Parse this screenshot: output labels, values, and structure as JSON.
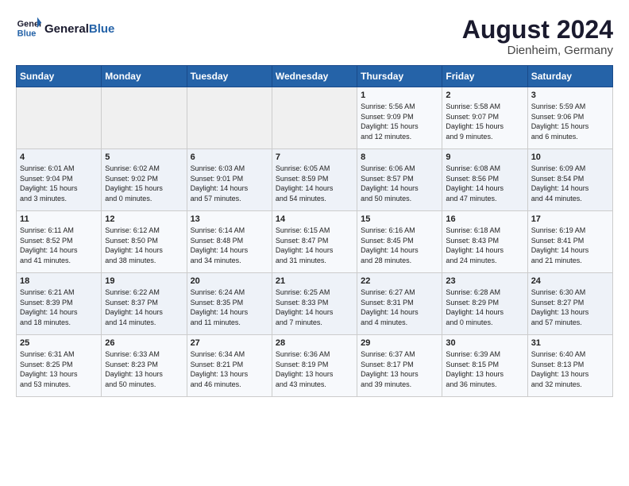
{
  "header": {
    "logo_line1": "General",
    "logo_line2": "Blue",
    "month_year": "August 2024",
    "location": "Dienheim, Germany"
  },
  "days_of_week": [
    "Sunday",
    "Monday",
    "Tuesday",
    "Wednesday",
    "Thursday",
    "Friday",
    "Saturday"
  ],
  "weeks": [
    [
      {
        "day": "",
        "info": ""
      },
      {
        "day": "",
        "info": ""
      },
      {
        "day": "",
        "info": ""
      },
      {
        "day": "",
        "info": ""
      },
      {
        "day": "1",
        "info": "Sunrise: 5:56 AM\nSunset: 9:09 PM\nDaylight: 15 hours\nand 12 minutes."
      },
      {
        "day": "2",
        "info": "Sunrise: 5:58 AM\nSunset: 9:07 PM\nDaylight: 15 hours\nand 9 minutes."
      },
      {
        "day": "3",
        "info": "Sunrise: 5:59 AM\nSunset: 9:06 PM\nDaylight: 15 hours\nand 6 minutes."
      }
    ],
    [
      {
        "day": "4",
        "info": "Sunrise: 6:01 AM\nSunset: 9:04 PM\nDaylight: 15 hours\nand 3 minutes."
      },
      {
        "day": "5",
        "info": "Sunrise: 6:02 AM\nSunset: 9:02 PM\nDaylight: 15 hours\nand 0 minutes."
      },
      {
        "day": "6",
        "info": "Sunrise: 6:03 AM\nSunset: 9:01 PM\nDaylight: 14 hours\nand 57 minutes."
      },
      {
        "day": "7",
        "info": "Sunrise: 6:05 AM\nSunset: 8:59 PM\nDaylight: 14 hours\nand 54 minutes."
      },
      {
        "day": "8",
        "info": "Sunrise: 6:06 AM\nSunset: 8:57 PM\nDaylight: 14 hours\nand 50 minutes."
      },
      {
        "day": "9",
        "info": "Sunrise: 6:08 AM\nSunset: 8:56 PM\nDaylight: 14 hours\nand 47 minutes."
      },
      {
        "day": "10",
        "info": "Sunrise: 6:09 AM\nSunset: 8:54 PM\nDaylight: 14 hours\nand 44 minutes."
      }
    ],
    [
      {
        "day": "11",
        "info": "Sunrise: 6:11 AM\nSunset: 8:52 PM\nDaylight: 14 hours\nand 41 minutes."
      },
      {
        "day": "12",
        "info": "Sunrise: 6:12 AM\nSunset: 8:50 PM\nDaylight: 14 hours\nand 38 minutes."
      },
      {
        "day": "13",
        "info": "Sunrise: 6:14 AM\nSunset: 8:48 PM\nDaylight: 14 hours\nand 34 minutes."
      },
      {
        "day": "14",
        "info": "Sunrise: 6:15 AM\nSunset: 8:47 PM\nDaylight: 14 hours\nand 31 minutes."
      },
      {
        "day": "15",
        "info": "Sunrise: 6:16 AM\nSunset: 8:45 PM\nDaylight: 14 hours\nand 28 minutes."
      },
      {
        "day": "16",
        "info": "Sunrise: 6:18 AM\nSunset: 8:43 PM\nDaylight: 14 hours\nand 24 minutes."
      },
      {
        "day": "17",
        "info": "Sunrise: 6:19 AM\nSunset: 8:41 PM\nDaylight: 14 hours\nand 21 minutes."
      }
    ],
    [
      {
        "day": "18",
        "info": "Sunrise: 6:21 AM\nSunset: 8:39 PM\nDaylight: 14 hours\nand 18 minutes."
      },
      {
        "day": "19",
        "info": "Sunrise: 6:22 AM\nSunset: 8:37 PM\nDaylight: 14 hours\nand 14 minutes."
      },
      {
        "day": "20",
        "info": "Sunrise: 6:24 AM\nSunset: 8:35 PM\nDaylight: 14 hours\nand 11 minutes."
      },
      {
        "day": "21",
        "info": "Sunrise: 6:25 AM\nSunset: 8:33 PM\nDaylight: 14 hours\nand 7 minutes."
      },
      {
        "day": "22",
        "info": "Sunrise: 6:27 AM\nSunset: 8:31 PM\nDaylight: 14 hours\nand 4 minutes."
      },
      {
        "day": "23",
        "info": "Sunrise: 6:28 AM\nSunset: 8:29 PM\nDaylight: 14 hours\nand 0 minutes."
      },
      {
        "day": "24",
        "info": "Sunrise: 6:30 AM\nSunset: 8:27 PM\nDaylight: 13 hours\nand 57 minutes."
      }
    ],
    [
      {
        "day": "25",
        "info": "Sunrise: 6:31 AM\nSunset: 8:25 PM\nDaylight: 13 hours\nand 53 minutes."
      },
      {
        "day": "26",
        "info": "Sunrise: 6:33 AM\nSunset: 8:23 PM\nDaylight: 13 hours\nand 50 minutes."
      },
      {
        "day": "27",
        "info": "Sunrise: 6:34 AM\nSunset: 8:21 PM\nDaylight: 13 hours\nand 46 minutes."
      },
      {
        "day": "28",
        "info": "Sunrise: 6:36 AM\nSunset: 8:19 PM\nDaylight: 13 hours\nand 43 minutes."
      },
      {
        "day": "29",
        "info": "Sunrise: 6:37 AM\nSunset: 8:17 PM\nDaylight: 13 hours\nand 39 minutes."
      },
      {
        "day": "30",
        "info": "Sunrise: 6:39 AM\nSunset: 8:15 PM\nDaylight: 13 hours\nand 36 minutes."
      },
      {
        "day": "31",
        "info": "Sunrise: 6:40 AM\nSunset: 8:13 PM\nDaylight: 13 hours\nand 32 minutes."
      }
    ]
  ]
}
